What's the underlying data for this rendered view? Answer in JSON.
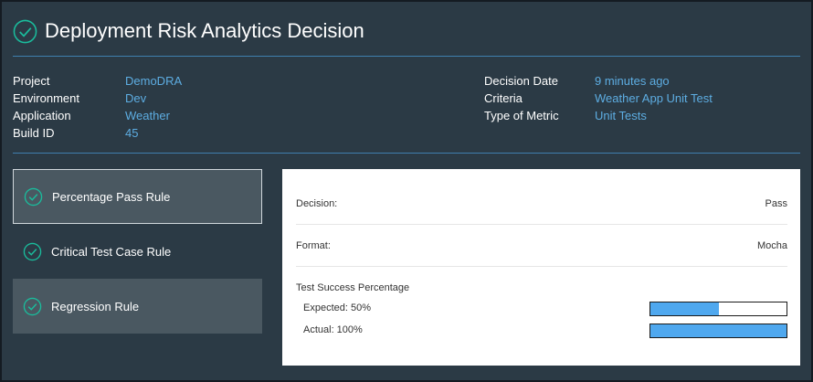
{
  "header": {
    "title": "Deployment Risk Analytics Decision",
    "icon": "check-circle-icon"
  },
  "meta_left": [
    {
      "label": "Project",
      "value": "DemoDRA"
    },
    {
      "label": "Environment",
      "value": "Dev"
    },
    {
      "label": "Application",
      "value": "Weather"
    },
    {
      "label": "Build ID",
      "value": "45"
    }
  ],
  "meta_right": [
    {
      "label": "Decision Date",
      "value": "9 minutes ago"
    },
    {
      "label": "Criteria",
      "value": "Weather App Unit Test"
    },
    {
      "label": "Type of Metric",
      "value": "Unit Tests"
    }
  ],
  "rules": [
    {
      "label": "Percentage Pass Rule",
      "status": "passed",
      "icon": "check-circle-icon",
      "selected": true
    },
    {
      "label": "Critical Test Case Rule",
      "status": "passed",
      "icon": "check-circle-icon",
      "selected": false
    },
    {
      "label": "Regression Rule",
      "status": "passed",
      "icon": "check-circle-icon",
      "selected": false
    }
  ],
  "detail": {
    "decision": {
      "label": "Decision:",
      "value": "Pass"
    },
    "format": {
      "label": "Format:",
      "value": "Mocha"
    },
    "success_title": "Test Success Percentage",
    "expected": {
      "label": "Expected: 50%",
      "percent": 50
    },
    "actual": {
      "label": "Actual: 100%",
      "percent": 100
    }
  },
  "colors": {
    "accent": "#1abc9c",
    "link": "#5dade2",
    "bar_fill": "#4fa8ef",
    "background": "#2b3a45",
    "selected_background": "#4a5861"
  }
}
